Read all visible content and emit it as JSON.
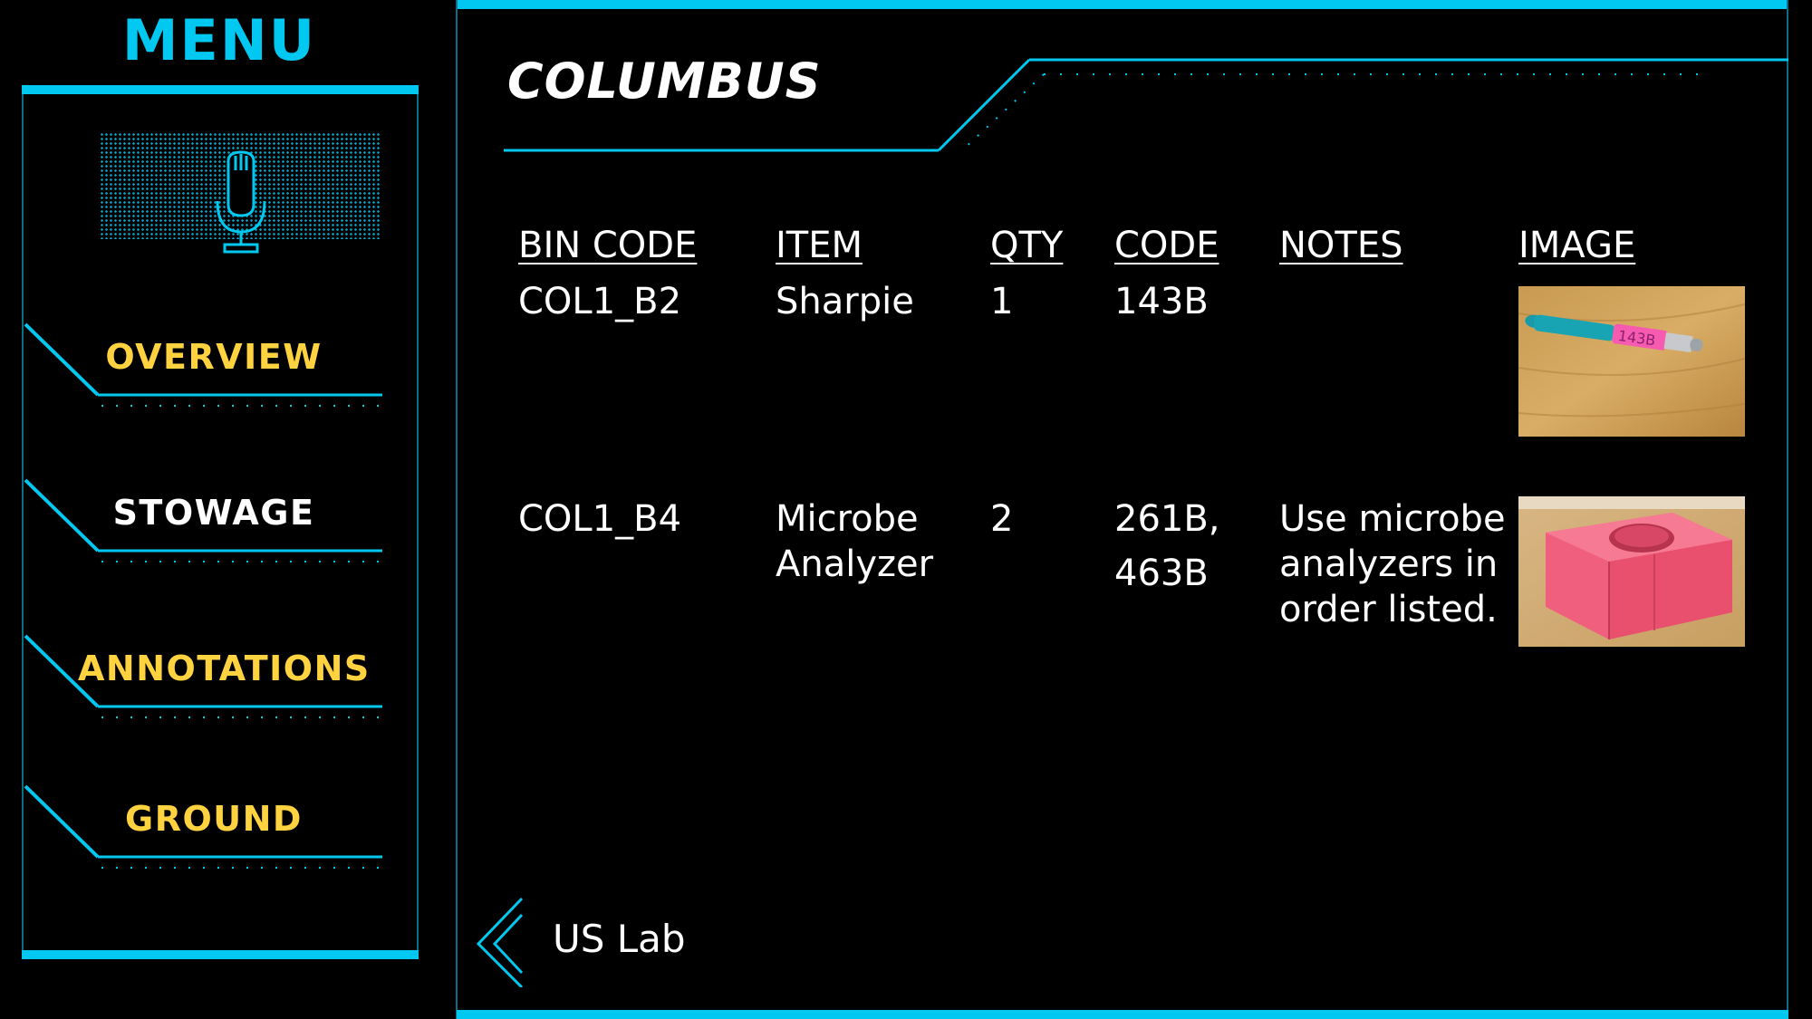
{
  "menu": {
    "title": "MENU",
    "items": [
      {
        "label": "OVERVIEW",
        "color": "#ffd23f"
      },
      {
        "label": "STOWAGE",
        "color": "#ffffff"
      },
      {
        "label": "ANNOTATIONS",
        "color": "#ffd23f"
      },
      {
        "label": "GROUND",
        "color": "#ffd23f"
      }
    ],
    "voice_icon": "microphone-icon"
  },
  "page": {
    "title": "COLUMBUS"
  },
  "table": {
    "headers": [
      "BIN CODE",
      "ITEM",
      "QTY",
      "CODE",
      "NOTES",
      "IMAGE"
    ],
    "rows": [
      {
        "bin_code": "COL1_B2",
        "item": "Sharpie",
        "qty": "1",
        "code": "143B",
        "notes": "",
        "image": "sharpie-marker-photo"
      },
      {
        "bin_code": "COL1_B4",
        "item_line1": "Microbe",
        "item_line2": "Analyzer",
        "qty": "2",
        "code_line1": "261B,",
        "code_line2": "463B",
        "notes_line1": "Use microbe",
        "notes_line2": "analyzers in",
        "notes_line3": "order listed.",
        "image": "microbe-analyzer-foam-photo"
      }
    ]
  },
  "back": {
    "label": "US Lab",
    "icon": "chevron-left-icon"
  },
  "colors": {
    "accent": "#00c8f0",
    "highlight": "#ffd23f",
    "background": "#000000"
  }
}
